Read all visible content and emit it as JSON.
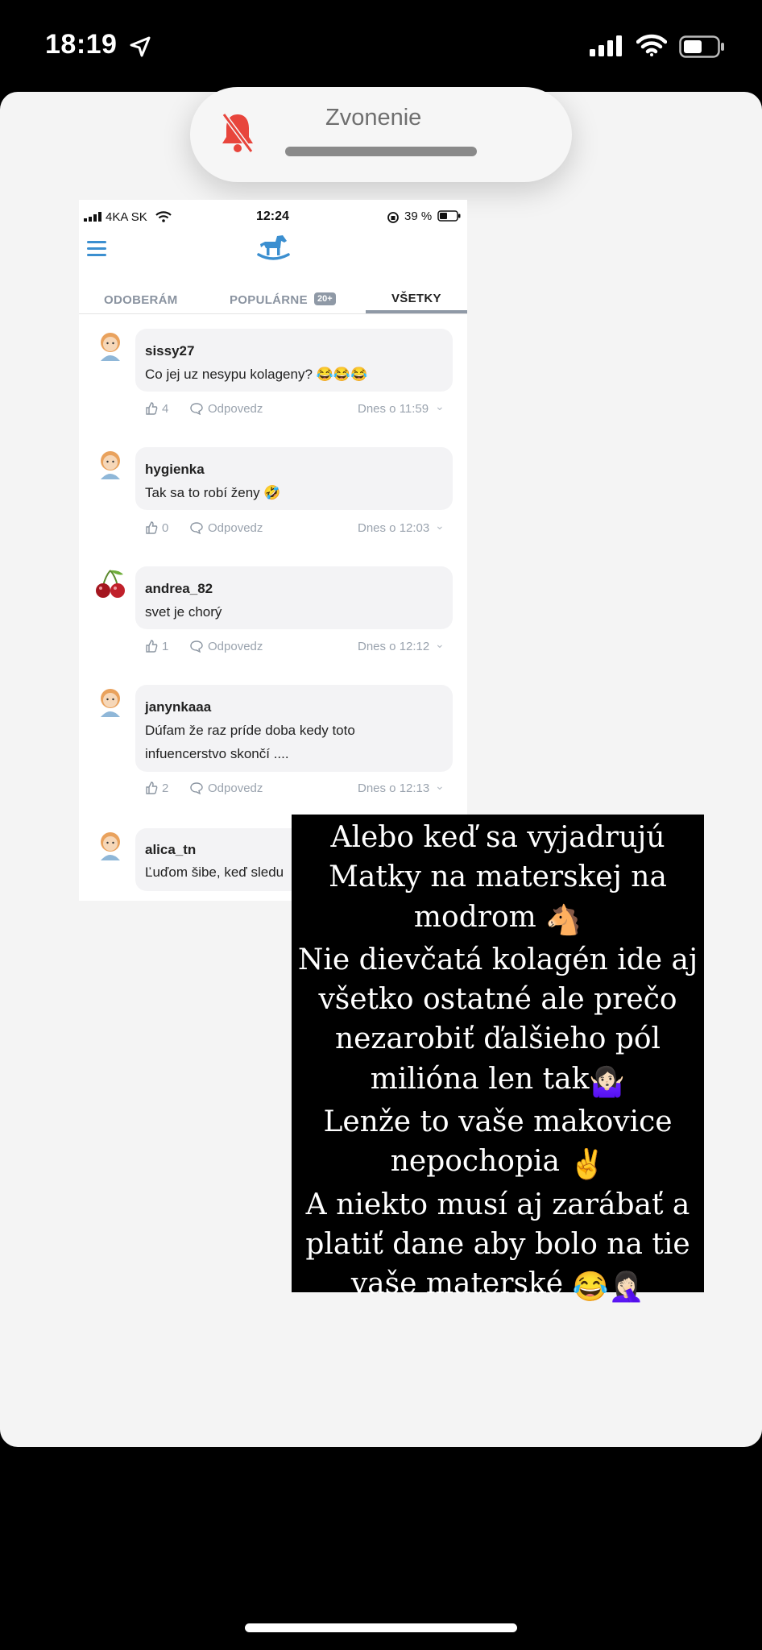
{
  "status_bar": {
    "time": "18:19"
  },
  "ringer_banner": {
    "label": "Zvonenie"
  },
  "embedded": {
    "status": {
      "carrier": "4KA SK",
      "time": "12:24",
      "battery": "39 %"
    },
    "tabs": [
      {
        "label": "ODOBERÁM"
      },
      {
        "label": "POPULÁRNE",
        "badge": "20+"
      },
      {
        "label": "VŠETKY"
      }
    ],
    "reply_label": "Odpovedz",
    "comments": [
      {
        "user": "sissy27",
        "text": "Co jej uz nesypu kolageny?",
        "likes": "4",
        "time": "Dnes o 11:59"
      },
      {
        "user": "hygienka",
        "text": "Tak sa to robí ženy",
        "likes": "0",
        "time": "Dnes o 12:03"
      },
      {
        "user": "andrea_82",
        "text": "svet je chorý",
        "likes": "1",
        "time": "Dnes o 12:12"
      },
      {
        "user": "janynkaaa",
        "text_line1": "Dúfam že raz príde doba kedy toto",
        "text_line2": "infuencerstvo skončí ....",
        "likes": "2",
        "time": "Dnes o 12:13"
      },
      {
        "user": "alica_tn",
        "text": "Ľuďom šibe, keď sledu"
      }
    ]
  },
  "story_text": {
    "l1": "Alebo keď sa vyjadrujú",
    "l2": "Matky na materskej na",
    "l3": "modrom",
    "l4": "Nie dievčatá kolagén ide aj",
    "l5": "všetko ostatné ale prečo",
    "l6": "nezarobiť ďalšieho pól",
    "l7": "milióna len tak",
    "l8": "Lenže to vaše makovice",
    "l9": "nepochopia",
    "l10": "A niekto musí aj zarábať a",
    "l11": "platiť dane aby bolo na tie",
    "l12": "vaše materské"
  },
  "icons": [
    "location-arrow-icon",
    "signal-icon",
    "wifi-icon",
    "battery-icon",
    "bell-muted-icon",
    "hamburger-icon",
    "rocking-horse-icon",
    "thumbs-up-icon",
    "speech-bubble-icon",
    "chevron-down-icon",
    "horse-emoji",
    "shrug-emoji",
    "victory-hand-emoji",
    "laughing-emoji",
    "facepalm-emoji"
  ],
  "colors": {
    "bell": "#e8453c",
    "brand_blue": "#3b8fd0",
    "page_bg": "#f4f4f4"
  }
}
